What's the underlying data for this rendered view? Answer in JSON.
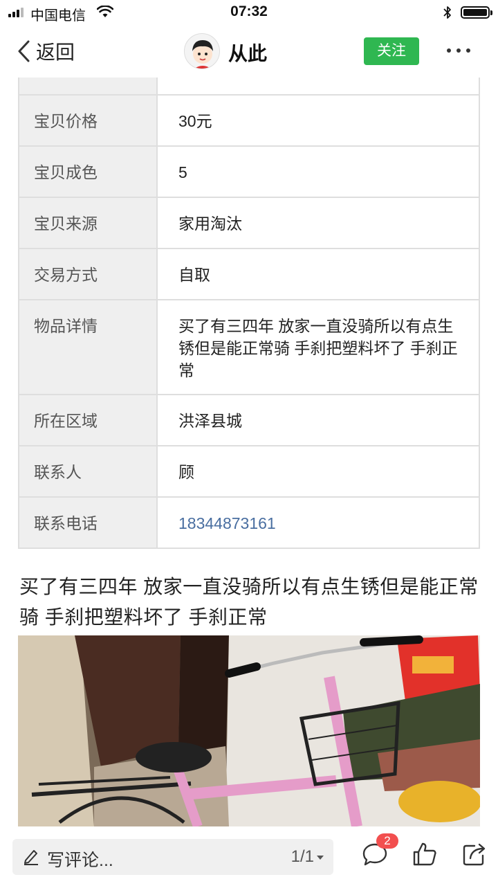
{
  "status_bar": {
    "carrier": "中国电信",
    "time": "07:32"
  },
  "nav": {
    "back_label": "返回",
    "title": "从此",
    "follow_label": "关注"
  },
  "info_table": {
    "rows": [
      {
        "label": "宝贝价格",
        "value": "30元"
      },
      {
        "label": "宝贝成色",
        "value": "5"
      },
      {
        "label": "宝贝来源",
        "value": "家用淘汰"
      },
      {
        "label": "交易方式",
        "value": "自取"
      },
      {
        "label": "物品详情",
        "value": "买了有三四年 放家一直没骑所以有点生锈但是能正常骑 手刹把塑料坏了 手刹正常"
      },
      {
        "label": "所在区域",
        "value": "洪泽县城"
      },
      {
        "label": "联系人",
        "value": "顾"
      },
      {
        "label": "联系电话",
        "value": "18344873161"
      }
    ]
  },
  "description": "买了有三四年  放家一直没骑所以有点生锈但是能正常骑  手刹把塑料坏了  手刹正常",
  "bottom_bar": {
    "comment_placeholder": "写评论...",
    "page_indicator": "1/1",
    "comment_count": "2"
  },
  "colors": {
    "follow_button": "#2fb751",
    "phone_link": "#496ea0",
    "badge": "#f24f4f",
    "table_label_bg": "#efefef",
    "table_border": "#dedede"
  },
  "icons": [
    "signal-icon",
    "wifi-icon",
    "bluetooth-icon",
    "battery-icon",
    "back-chevron-icon",
    "more-icon",
    "pen-icon",
    "comment-icon",
    "thumbs-up-icon",
    "share-icon"
  ]
}
